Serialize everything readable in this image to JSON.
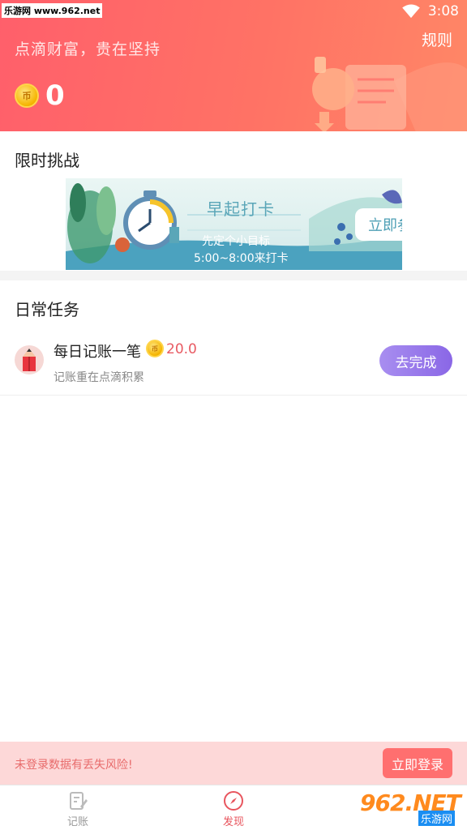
{
  "status_bar": {
    "watermark": "乐游网 www.962.net",
    "time": "3:08"
  },
  "header": {
    "slogan": "点滴财富，贵在坚持",
    "rules_link": "规则",
    "coin_symbol": "币",
    "coin_count": "0"
  },
  "challenge": {
    "section_title": "限时挑战",
    "banner_title": "早起打卡",
    "banner_subtitle": "先定个小目标",
    "banner_time": "5:00~8:00来打卡",
    "join_button": "立即参加"
  },
  "daily": {
    "section_title": "日常任务",
    "tasks": [
      {
        "name": "每日记账一笔",
        "coin_symbol": "币",
        "reward": "20.0",
        "description": "记账重在点滴积累",
        "action": "去完成"
      }
    ]
  },
  "login_notice": {
    "text": "未登录数据有丢失风险!",
    "button": "立即登录"
  },
  "bottom_nav": {
    "items": [
      {
        "label": "记账",
        "icon": "notebook-pen-icon",
        "active": false
      },
      {
        "label": "发现",
        "icon": "compass-icon",
        "active": true
      }
    ]
  },
  "site_badge": {
    "main": "962.NET",
    "sub": "乐游网"
  },
  "colors": {
    "header_gradient_start": "#ff5f6b",
    "header_gradient_end": "#ff8766",
    "accent_red": "#e8555e",
    "task_button_start": "#a88ef0",
    "task_button_end": "#8a67e6",
    "login_bar_bg": "#fdd8d8",
    "login_button_bg": "#ff6f6f"
  }
}
